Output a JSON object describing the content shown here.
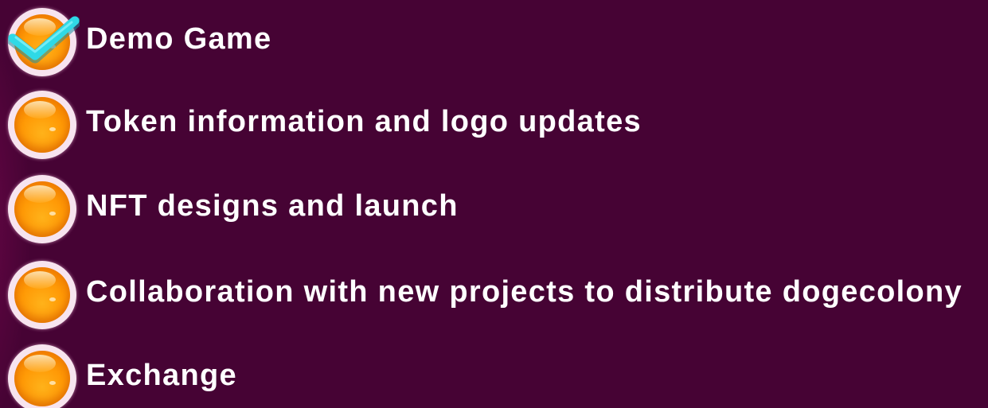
{
  "roadmap": {
    "items": [
      {
        "label": "Demo Game",
        "completed": true
      },
      {
        "label": "Token information and logo updates",
        "completed": false
      },
      {
        "label": "NFT designs and launch",
        "completed": false
      },
      {
        "label": "Collaboration with new projects to distribute dogecolony",
        "completed": false
      },
      {
        "label": "Exchange",
        "completed": false
      }
    ],
    "icons": {
      "bullet": "orange-orb-icon",
      "done": "checkmark-icon"
    },
    "colors": {
      "background": "#460334",
      "text": "#ffffff",
      "orb": "#ff9a06",
      "check": "#2fd9e6"
    }
  }
}
